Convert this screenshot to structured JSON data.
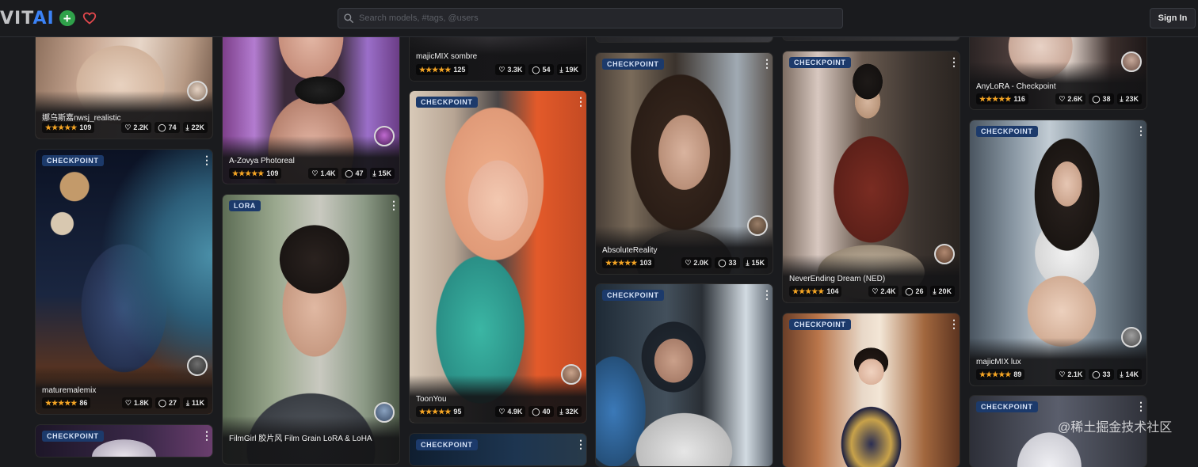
{
  "header": {
    "logo_text": "VIT",
    "logo_ai": "AI",
    "search_placeholder": "Search models, #tags, @users",
    "signin_label": "Sign In"
  },
  "icons": {
    "add": "plus-icon",
    "favorite": "heart-icon",
    "search": "search-icon",
    "menu": "kebab-icon",
    "likes": "heart-icon",
    "comments": "comment-icon",
    "downloads": "download-icon",
    "rating": "star-icon"
  },
  "colors": {
    "accent_blue": "#3b82f6",
    "plus_green": "#2fa14a",
    "heart_red": "#e5484d",
    "star": "#f5a524",
    "badge_bg": "#1c3a6b"
  },
  "stars": "★★★★★",
  "cards": [
    {
      "id": "c1",
      "badge": "",
      "title": "娜乌斯嘉nwsj_realistic",
      "rating_count": "109",
      "likes": "2.2K",
      "comments": "74",
      "downloads": "22K"
    },
    {
      "id": "c2",
      "badge": "CHECKPOINT",
      "title": "maturemalemix",
      "rating_count": "86",
      "likes": "1.8K",
      "comments": "27",
      "downloads": "11K"
    },
    {
      "id": "c3",
      "badge": "CHECKPOINT",
      "title": "",
      "rating_count": "",
      "likes": "",
      "comments": "",
      "downloads": ""
    },
    {
      "id": "c4",
      "badge": "",
      "title": "A-Zovya Photoreal",
      "rating_count": "109",
      "likes": "1.4K",
      "comments": "47",
      "downloads": "15K"
    },
    {
      "id": "c5",
      "badge": "LORA",
      "title": "FilmGirl 胶片风 Film Grain LoRA & LoHA",
      "rating_count": "",
      "likes": "",
      "comments": "",
      "downloads": ""
    },
    {
      "id": "c6",
      "badge": "",
      "title": "majicMIX sombre",
      "rating_count": "125",
      "likes": "3.3K",
      "comments": "54",
      "downloads": "19K"
    },
    {
      "id": "c7",
      "badge": "CHECKPOINT",
      "title": "ToonYou",
      "rating_count": "95",
      "likes": "4.9K",
      "comments": "40",
      "downloads": "32K"
    },
    {
      "id": "c8",
      "badge": "CHECKPOINT",
      "title": "",
      "rating_count": "",
      "likes": "",
      "comments": "",
      "downloads": ""
    },
    {
      "id": "c9",
      "badge": "CHECKPOINT",
      "title": "AbsoluteReality",
      "rating_count": "103",
      "likes": "2.0K",
      "comments": "33",
      "downloads": "15K"
    },
    {
      "id": "c10",
      "badge": "CHECKPOINT",
      "title": "",
      "rating_count": "",
      "likes": "",
      "comments": "",
      "downloads": ""
    },
    {
      "id": "c11",
      "badge": "CHECKPOINT",
      "title": "NeverEnding Dream (NED)",
      "rating_count": "104",
      "likes": "2.4K",
      "comments": "26",
      "downloads": "20K"
    },
    {
      "id": "c12",
      "badge": "CHECKPOINT",
      "title": "",
      "rating_count": "",
      "likes": "",
      "comments": "",
      "downloads": ""
    },
    {
      "id": "c13",
      "badge": "",
      "title": "AnyLoRA - Checkpoint",
      "rating_count": "116",
      "likes": "2.6K",
      "comments": "38",
      "downloads": "23K"
    },
    {
      "id": "c14",
      "badge": "CHECKPOINT",
      "title": "majicMIX lux",
      "rating_count": "89",
      "likes": "2.1K",
      "comments": "33",
      "downloads": "14K"
    },
    {
      "id": "c15",
      "badge": "CHECKPOINT",
      "title": "",
      "rating_count": "",
      "likes": "",
      "comments": "",
      "downloads": ""
    }
  ],
  "watermark": "@稀土掘金技术社区"
}
